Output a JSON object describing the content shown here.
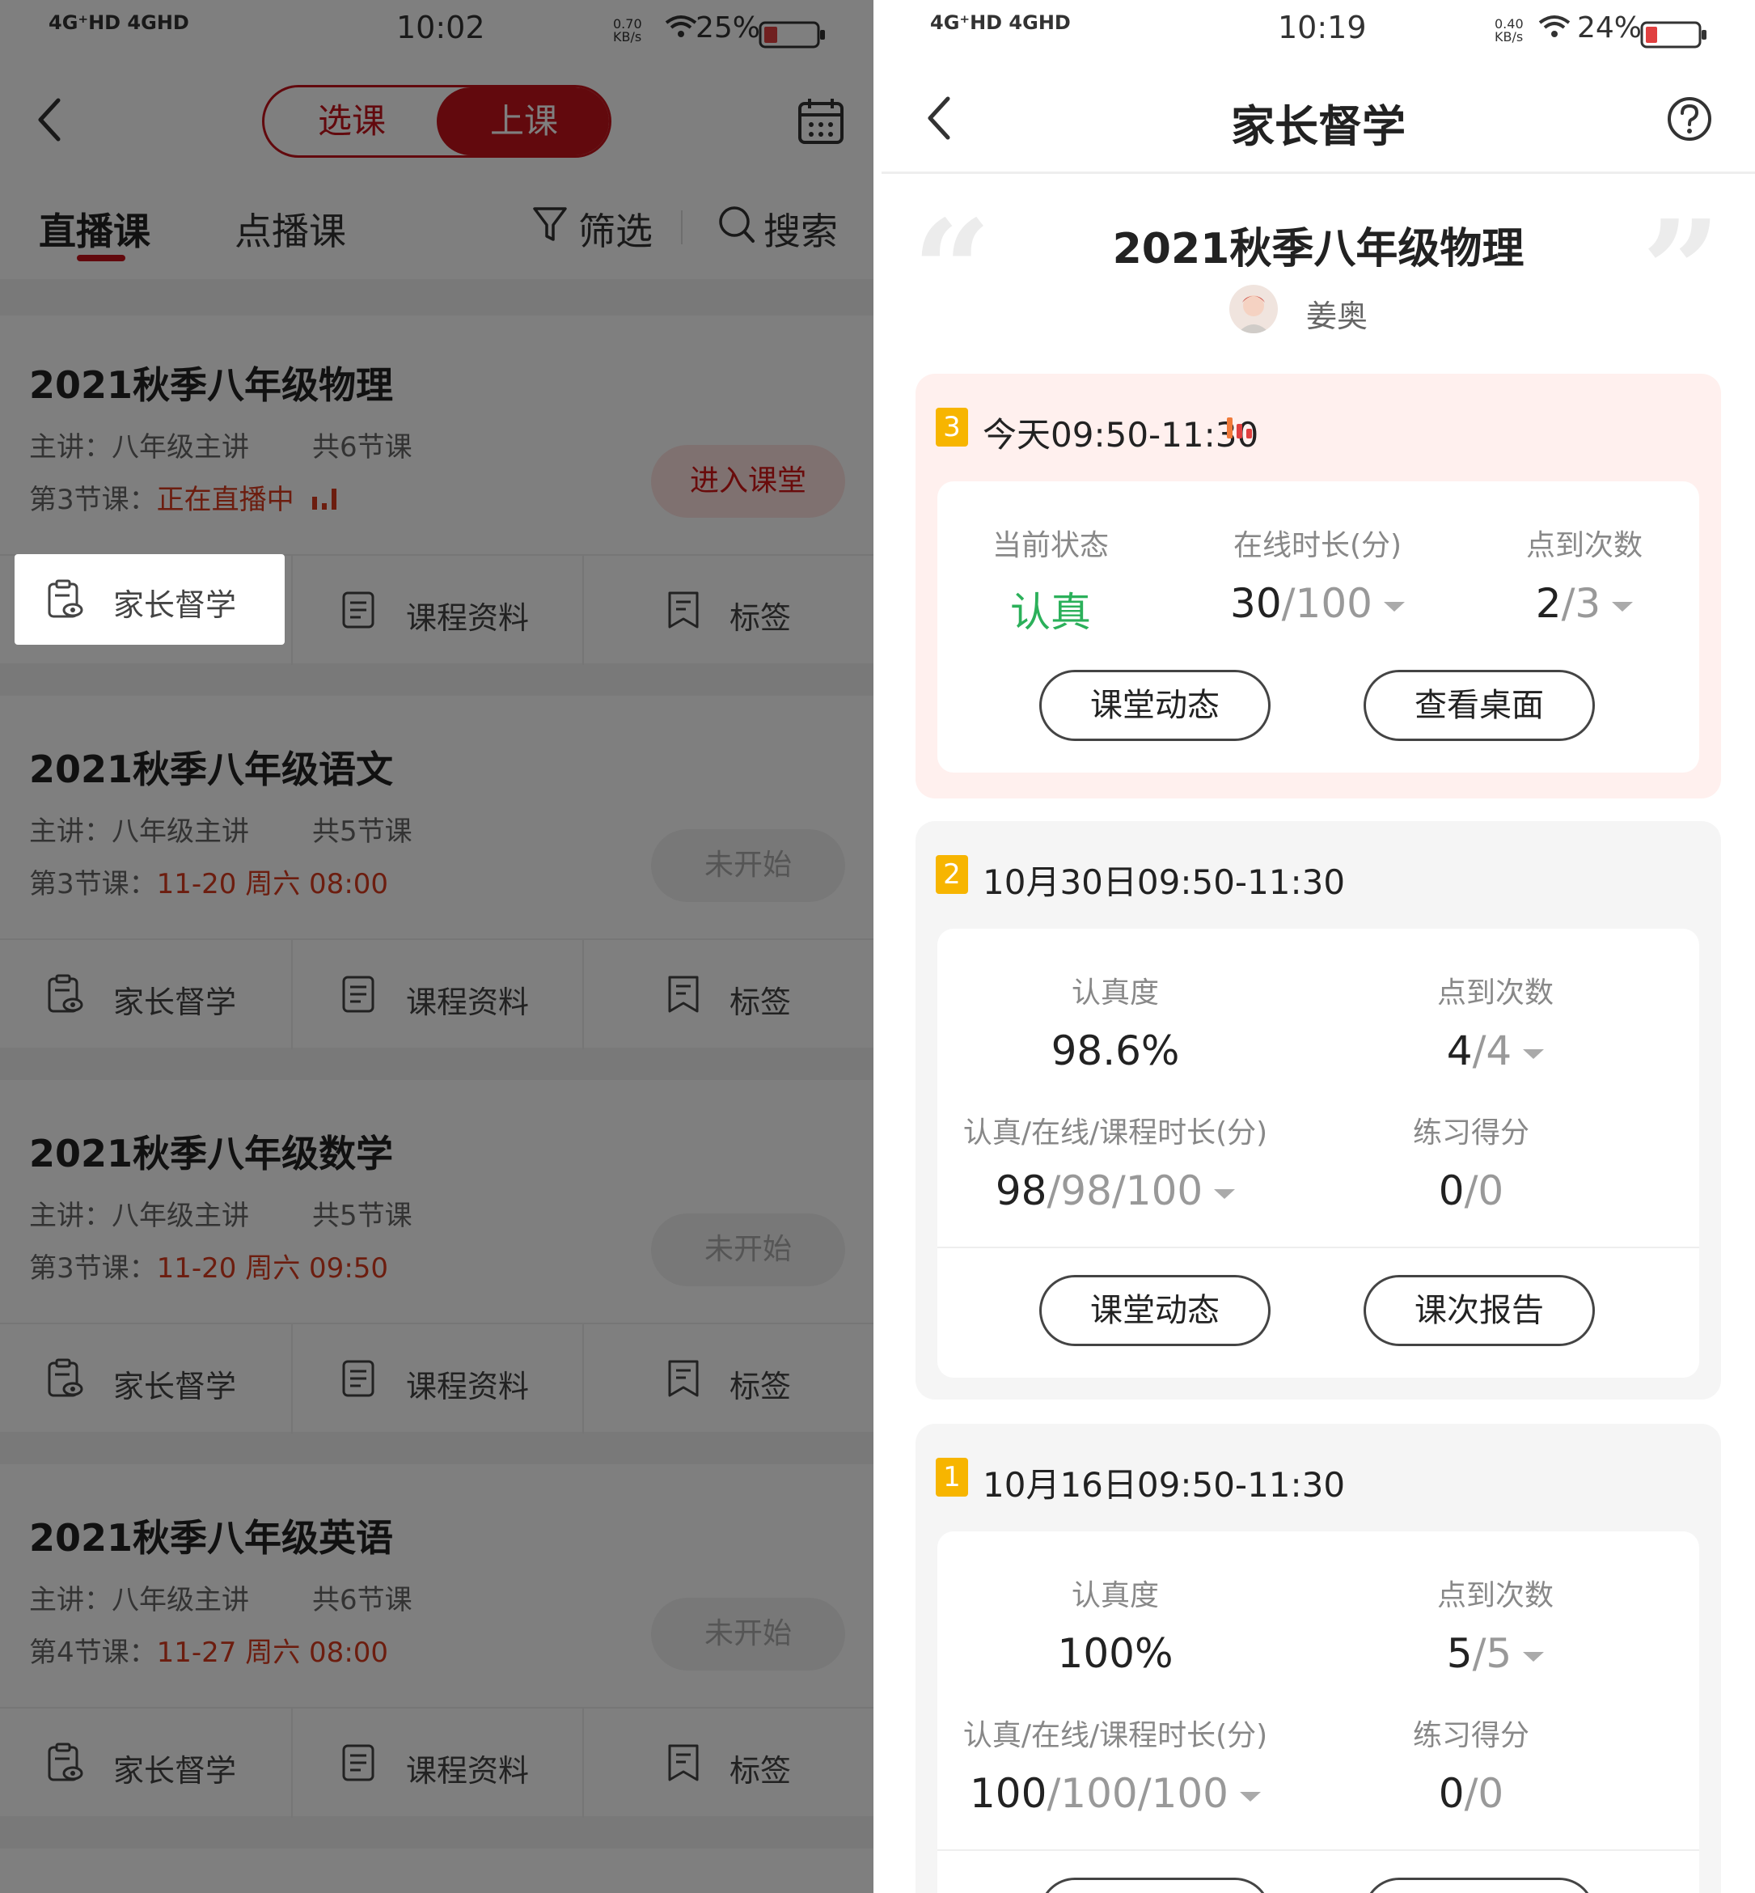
{
  "left": {
    "status": {
      "network": "4G⁺HD 4GHD",
      "time": "10:02",
      "speed": "0.70 KB/s",
      "battery": "25%"
    },
    "segment": {
      "option1": "选课",
      "option2": "上课"
    },
    "tabs": {
      "live": "直播课",
      "vod": "点播课",
      "filter": "筛选",
      "search": "搜索"
    },
    "courses": [
      {
        "title": "2021秋季八年级物理",
        "teacher": "主讲：八年级主讲",
        "count": "共6节课",
        "lesson_label": "第3节课：",
        "lesson_value": "正在直播中",
        "button": "进入课堂"
      },
      {
        "title": "2021秋季八年级语文",
        "teacher": "主讲：八年级主讲",
        "count": "共5节课",
        "lesson_label": "第3节课：",
        "lesson_value": "11-20 周六 08:00",
        "button": "未开始"
      },
      {
        "title": "2021秋季八年级数学",
        "teacher": "主讲：八年级主讲",
        "count": "共5节课",
        "lesson_label": "第3节课：",
        "lesson_value": "11-20 周六 09:50",
        "button": "未开始"
      },
      {
        "title": "2021秋季八年级英语",
        "teacher": "主讲：八年级主讲",
        "count": "共6节课",
        "lesson_label": "第4节课：",
        "lesson_value": "11-27 周六 08:00",
        "button": "未开始"
      }
    ],
    "actions": {
      "supervise": "家长督学",
      "materials": "课程资料",
      "tags": "标签"
    }
  },
  "right": {
    "status": {
      "network": "4G⁺HD 4GHD",
      "time": "10:19",
      "speed": "0.40 KB/s",
      "battery": "24%"
    },
    "title": "家长督学",
    "course_title": "2021秋季八年级物理",
    "teacher_name": "姜奥",
    "sessions": [
      {
        "num": "3",
        "when": "今天09:50-11:30",
        "live": true,
        "stats": [
          {
            "k": "当前状态",
            "v": "认真"
          },
          {
            "k": "在线时长(分)",
            "num": "30",
            "den": "/100"
          },
          {
            "k": "点到次数",
            "num": "2",
            "den": "/3"
          }
        ],
        "buttons": [
          "课堂动态",
          "查看桌面"
        ]
      },
      {
        "num": "2",
        "when": "10月30日09:50-11:30",
        "stats": [
          {
            "k": "认真度",
            "v": "98.6%"
          },
          {
            "k": "点到次数",
            "num": "4",
            "den": "/4"
          },
          {
            "k": "认真/在线/课程时长(分)",
            "num": "98",
            "den": "/98/100"
          },
          {
            "k": "练习得分",
            "num": "0",
            "den": "/0"
          }
        ],
        "buttons": [
          "课堂动态",
          "课次报告"
        ]
      },
      {
        "num": "1",
        "when": "10月16日09:50-11:30",
        "stats": [
          {
            "k": "认真度",
            "v": "100%"
          },
          {
            "k": "点到次数",
            "num": "5",
            "den": "/5"
          },
          {
            "k": "认真/在线/课程时长(分)",
            "num": "100",
            "den": "/100/100"
          },
          {
            "k": "练习得分",
            "num": "0",
            "den": "/0"
          }
        ]
      }
    ]
  },
  "colors": {
    "brand_red": "#c4121a",
    "live_orange": "#d93b1e",
    "focus_green": "#2bb05a",
    "badge_yellow": "#f7b500",
    "today_card_bg": "#fff0ee",
    "past_card_bg": "#f5f5f5"
  }
}
